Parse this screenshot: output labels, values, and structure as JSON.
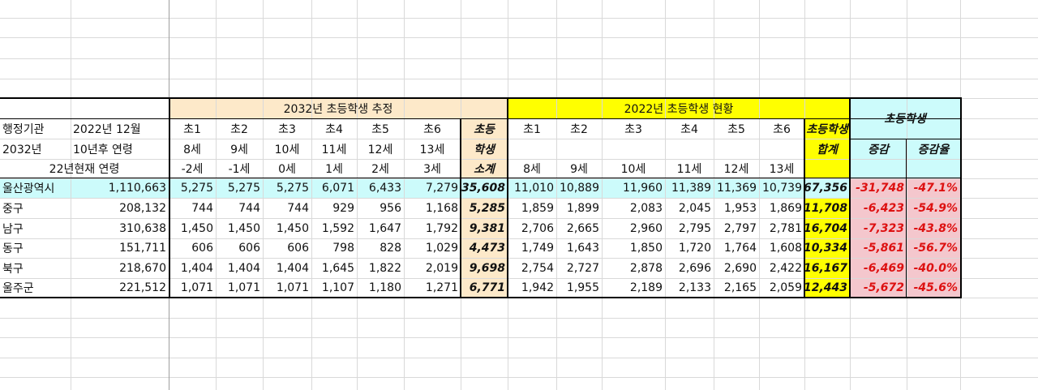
{
  "header": {
    "est_title": "2032년 초등학생 추정",
    "cur_title": "2022년 초등학생 현황",
    "students_title": "초등학생"
  },
  "labels": {
    "admin": "행정기관",
    "year2032": "2032년",
    "age22": "22년현재 연령",
    "base_date": "2022년 12월",
    "after10": "10년후 연령",
    "subtotal": [
      "초등",
      "학생",
      "소계"
    ],
    "total": [
      "초등학생",
      "합계"
    ],
    "change": "증감",
    "change_rate": "증감율"
  },
  "grades_est": [
    "초1",
    "초2",
    "초3",
    "초4",
    "초5",
    "초6"
  ],
  "ages_2032": [
    "8세",
    "9세",
    "10세",
    "11세",
    "12세",
    "13세"
  ],
  "ages_2022": [
    "-2세",
    "-1세",
    "0세",
    "1세",
    "2세",
    "3세"
  ],
  "grades_cur": [
    "초1",
    "초2",
    "초3",
    "초4",
    "초5",
    "초6"
  ],
  "ages_cur": [
    "8세",
    "9세",
    "10세",
    "11세",
    "12세",
    "13세"
  ],
  "rows": [
    {
      "name": "울산광역시",
      "pop": "1,110,663",
      "est": [
        "5,275",
        "5,275",
        "5,275",
        "6,071",
        "6,433",
        "7,279"
      ],
      "est_sum": "35,608",
      "cur": [
        "11,010",
        "10,889",
        "11,960",
        "11,389",
        "11,369",
        "10,739"
      ],
      "cur_sum": "67,356",
      "diff": "-31,748",
      "rate": "-47.1%"
    },
    {
      "name": "중구",
      "pop": "208,132",
      "est": [
        "744",
        "744",
        "744",
        "929",
        "956",
        "1,168"
      ],
      "est_sum": "5,285",
      "cur": [
        "1,859",
        "1,899",
        "2,083",
        "2,045",
        "1,953",
        "1,869"
      ],
      "cur_sum": "11,708",
      "diff": "-6,423",
      "rate": "-54.9%"
    },
    {
      "name": "남구",
      "pop": "310,638",
      "est": [
        "1,450",
        "1,450",
        "1,450",
        "1,592",
        "1,647",
        "1,792"
      ],
      "est_sum": "9,381",
      "cur": [
        "2,706",
        "2,665",
        "2,960",
        "2,795",
        "2,797",
        "2,781"
      ],
      "cur_sum": "16,704",
      "diff": "-7,323",
      "rate": "-43.8%"
    },
    {
      "name": "동구",
      "pop": "151,711",
      "est": [
        "606",
        "606",
        "606",
        "798",
        "828",
        "1,029"
      ],
      "est_sum": "4,473",
      "cur": [
        "1,749",
        "1,643",
        "1,850",
        "1,720",
        "1,764",
        "1,608"
      ],
      "cur_sum": "10,334",
      "diff": "-5,861",
      "rate": "-56.7%"
    },
    {
      "name": "북구",
      "pop": "218,670",
      "est": [
        "1,404",
        "1,404",
        "1,404",
        "1,645",
        "1,822",
        "2,019"
      ],
      "est_sum": "9,698",
      "cur": [
        "2,754",
        "2,727",
        "2,878",
        "2,696",
        "2,690",
        "2,422"
      ],
      "cur_sum": "16,167",
      "diff": "-6,469",
      "rate": "-40.0%"
    },
    {
      "name": "울주군",
      "pop": "221,512",
      "est": [
        "1,071",
        "1,071",
        "1,071",
        "1,107",
        "1,180",
        "1,271"
      ],
      "est_sum": "6,771",
      "cur": [
        "1,942",
        "1,955",
        "2,189",
        "2,133",
        "2,165",
        "2,059"
      ],
      "cur_sum": "12,443",
      "diff": "-5,672",
      "rate": "-45.6%"
    }
  ],
  "colors": {
    "est_header": "#fde9c9",
    "cur_header": "#ffff00",
    "teal": "#ccfbfb",
    "pink": "#f4c7cd",
    "text_negative": "#dd1111"
  }
}
